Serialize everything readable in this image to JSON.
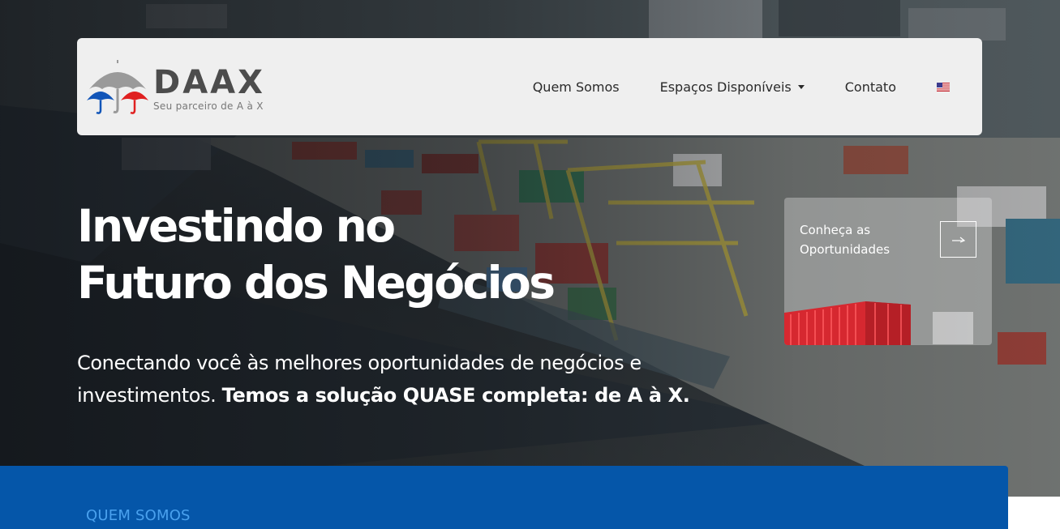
{
  "brand": {
    "name": "DAAX",
    "tagline": "Seu parceiro de A à X",
    "colors": {
      "umbrella_gray": "#9a9a9a",
      "umbrella_blue": "#1155b8",
      "umbrella_red": "#e02020"
    }
  },
  "nav": {
    "items": [
      {
        "label": "Quem Somos",
        "has_dropdown": false
      },
      {
        "label": "Espaços Disponíveis",
        "has_dropdown": true
      },
      {
        "label": "Contato",
        "has_dropdown": false
      }
    ],
    "language_flag": "us-flag-icon"
  },
  "hero": {
    "title_line1": "Investindo no",
    "title_line2": "Futuro dos Negócios",
    "subtitle_plain": "Conectando você às melhores oportunidades de negócios e investimentos.",
    "subtitle_bold": "Temos a solução QUASE completa: de A à X."
  },
  "opportunity_card": {
    "label_line1": "Conheça as",
    "label_line2": "Oportunidades",
    "arrow_icon": "arrow-right-icon"
  },
  "about_section": {
    "label": "QUEM SOMOS",
    "background": "#0556a9",
    "label_color": "#4aa1ee"
  }
}
